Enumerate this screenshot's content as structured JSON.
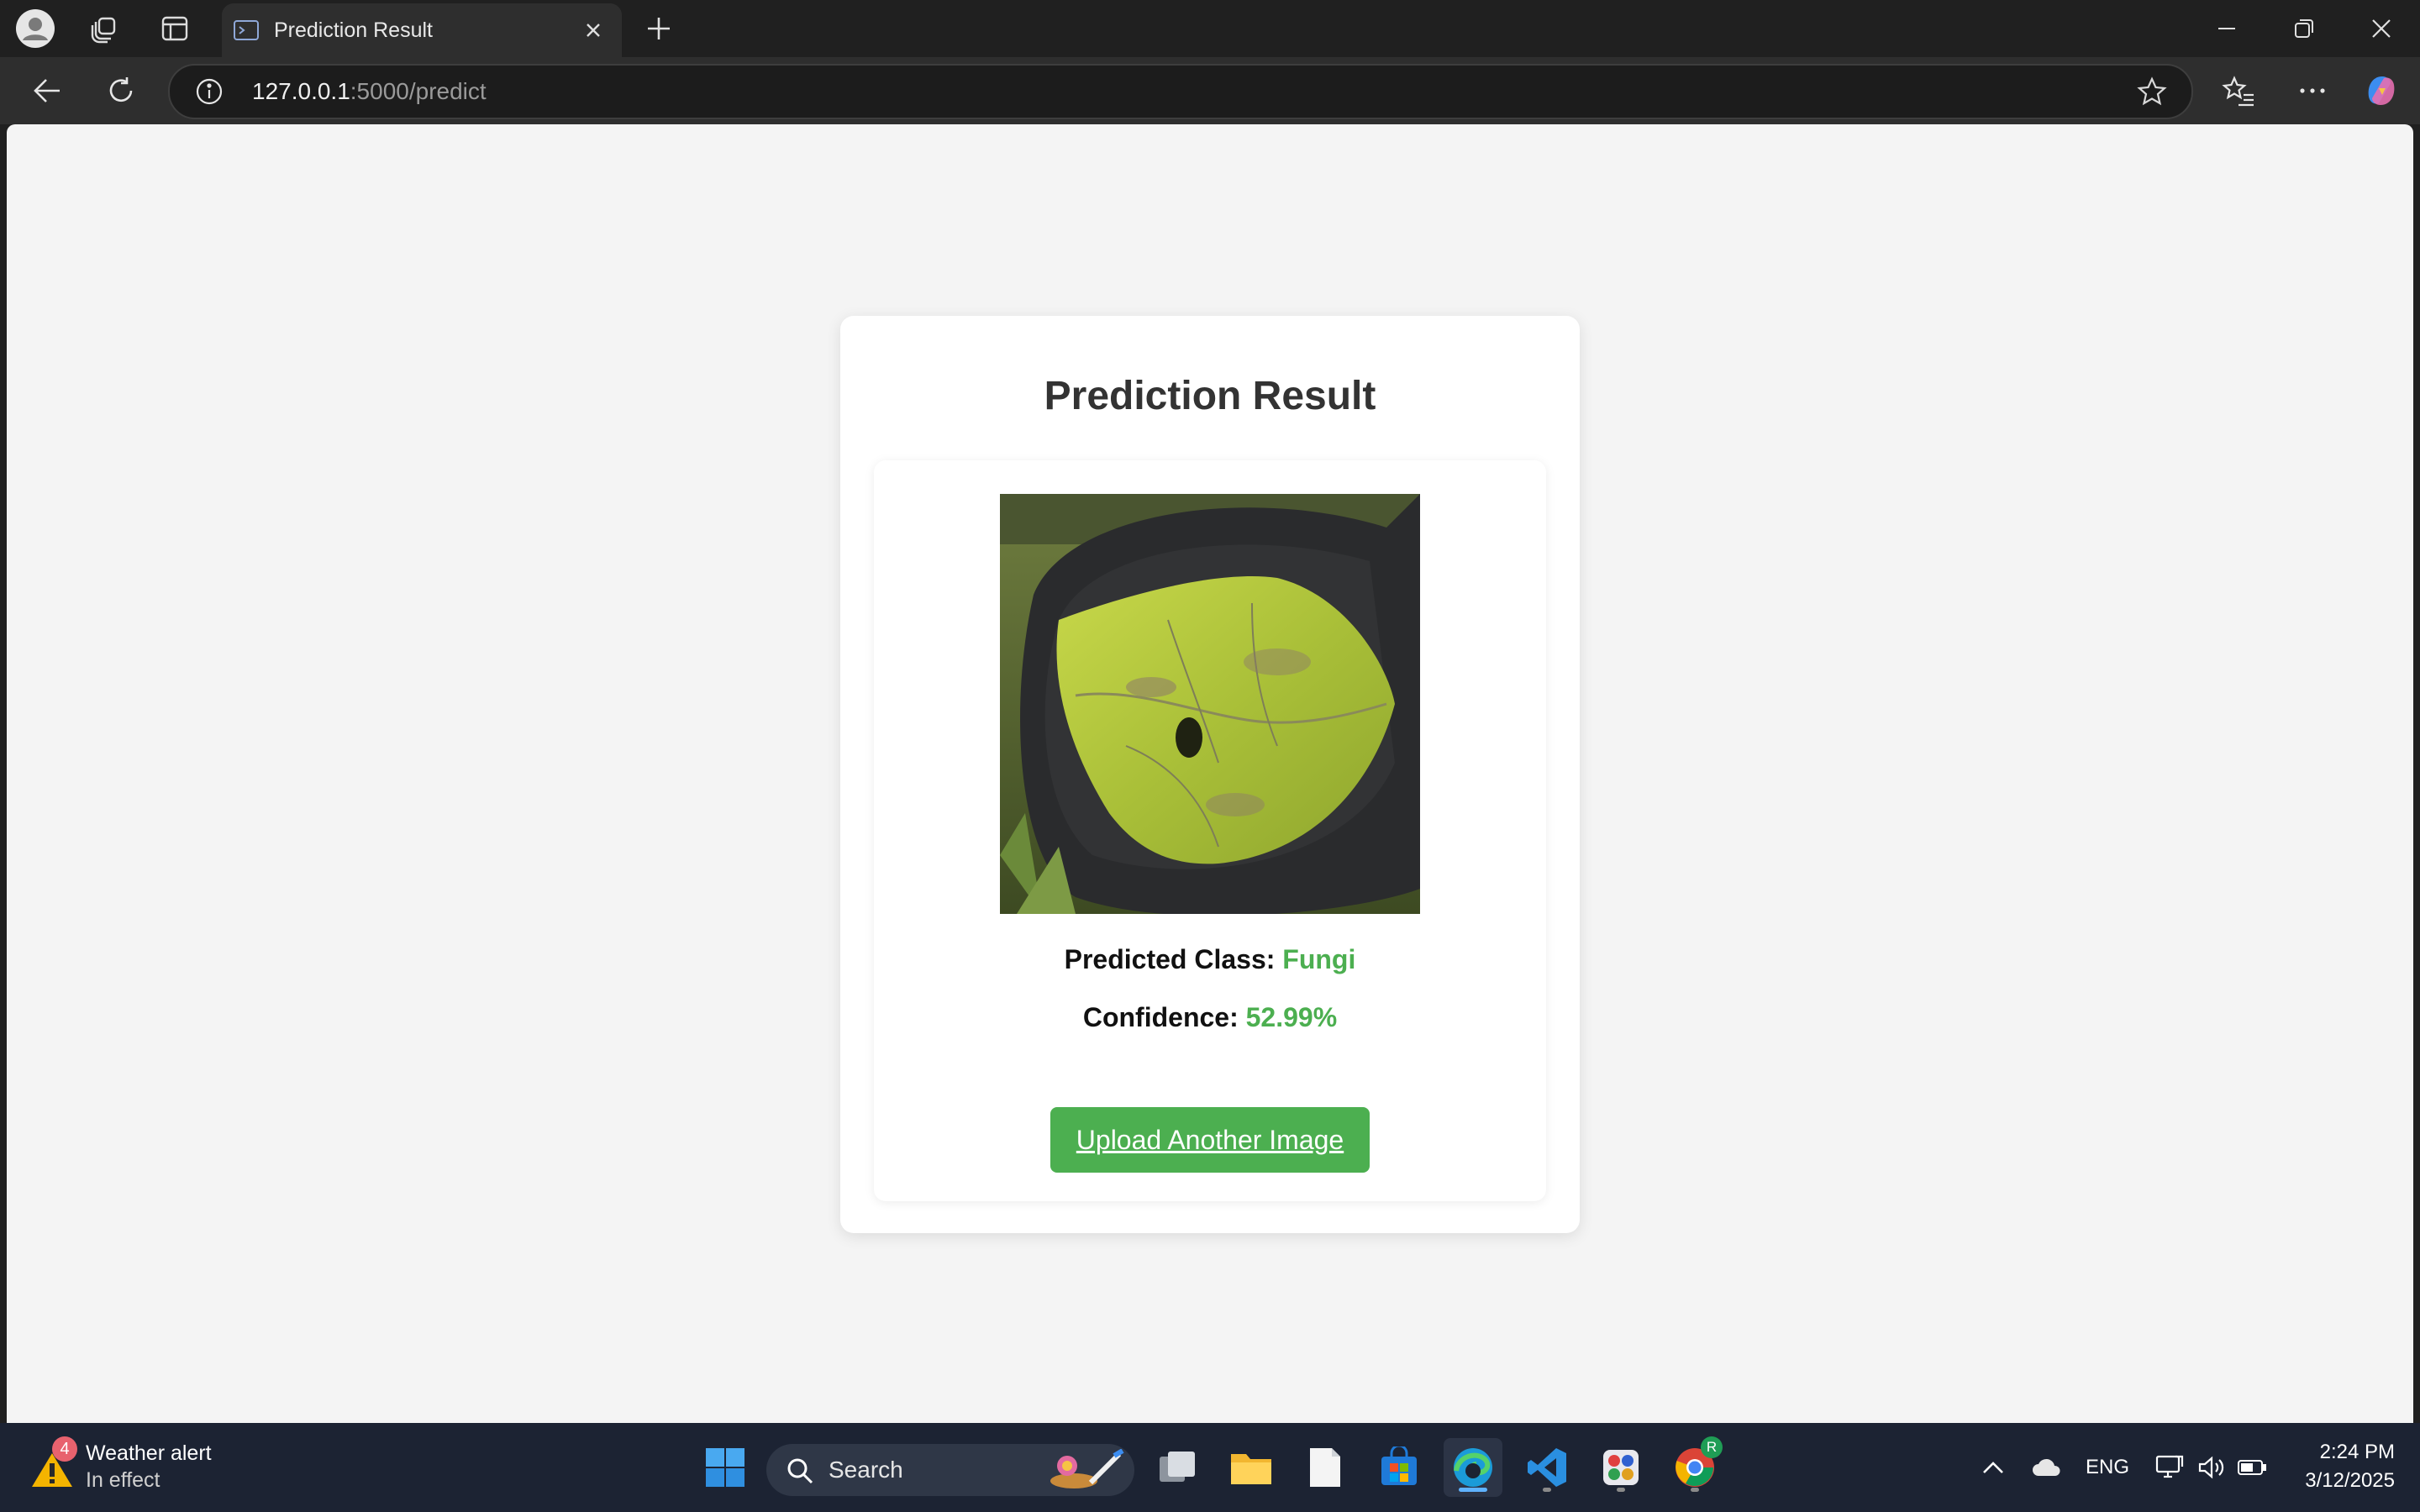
{
  "browser": {
    "tab": {
      "title": "Prediction Result"
    },
    "address": {
      "host": "127.0.0.1",
      "path": ":5000/predict"
    }
  },
  "page": {
    "heading": "Prediction Result",
    "image": {
      "description": "leaf-photo"
    },
    "predicted_class": {
      "label": "Predicted Class:",
      "value": "Fungi"
    },
    "confidence": {
      "label": "Confidence:",
      "value": "52.99%"
    },
    "upload_button": "Upload Another Image",
    "accent_color": "#4caf50"
  },
  "taskbar": {
    "weather": {
      "title": "Weather alert",
      "subtitle": "In effect",
      "badge": "4"
    },
    "search": {
      "label": "Search"
    },
    "language": "ENG",
    "clock": {
      "time": "2:24 PM",
      "date": "3/12/2025"
    },
    "chrome_badge": "R"
  }
}
